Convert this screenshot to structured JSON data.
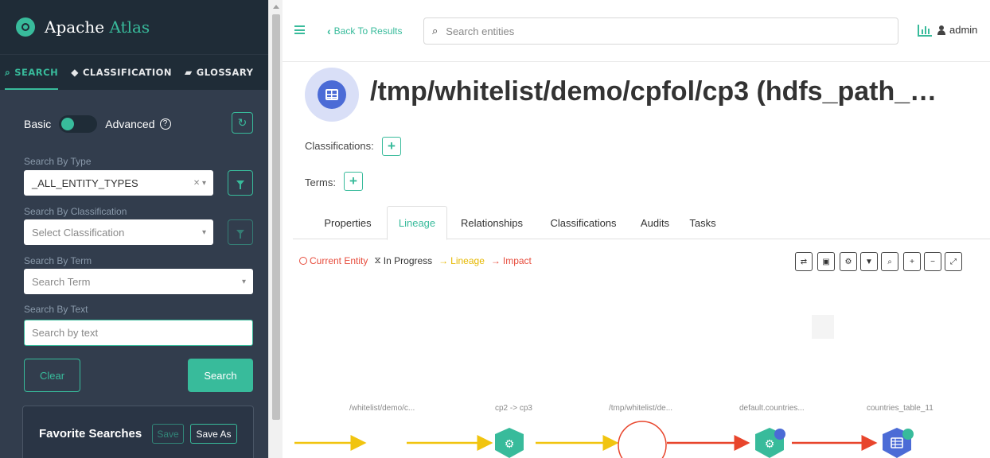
{
  "sidebar": {
    "brand_prefix": "Apache ",
    "brand_accent": "Atlas",
    "tabs": [
      {
        "label": "SEARCH",
        "icon": "search-icon"
      },
      {
        "label": "CLASSIFICATION",
        "icon": "tag-icon"
      },
      {
        "label": "GLOSSARY",
        "icon": "folder-icon"
      }
    ],
    "toggle_basic": "Basic",
    "toggle_advanced": "Advanced",
    "search_by_type_label": "Search By Type",
    "search_by_type_value": "_ALL_ENTITY_TYPES",
    "search_by_classification_label": "Search By Classification",
    "search_by_classification_placeholder": "Select Classification",
    "search_by_term_label": "Search By Term",
    "search_by_term_placeholder": "Search Term",
    "search_by_text_label": "Search By Text",
    "search_by_text_placeholder": "Search by text",
    "clear_label": "Clear",
    "search_label": "Search",
    "favorites_title": "Favorite Searches",
    "save_label": "Save",
    "save_as_label": "Save As"
  },
  "header": {
    "back_label": "Back To Results",
    "search_placeholder": "Search entities",
    "user": "admin"
  },
  "entity": {
    "title": "/tmp/whitelist/demo/cpfol/cp3 (hdfs_path_…",
    "classifications_label": "Classifications:",
    "terms_label": "Terms:"
  },
  "tabs": [
    "Properties",
    "Lineage",
    "Relationships",
    "Classifications",
    "Audits",
    "Tasks"
  ],
  "legend": {
    "current": "Current Entity",
    "progress": "In Progress",
    "lineage": "Lineage",
    "impact": "Impact"
  },
  "lineage_nodes": [
    "/whitelist/demo/c...",
    "cp2 -> cp3",
    "/tmp/whitelist/de...",
    "default.countries...",
    "countries_table_11"
  ],
  "colors": {
    "accent": "#38bb9b",
    "sidebar_bg": "#323d4d",
    "lineage": "#f1c40f",
    "impact": "#e8452c",
    "entity": "#4b6bd6"
  }
}
